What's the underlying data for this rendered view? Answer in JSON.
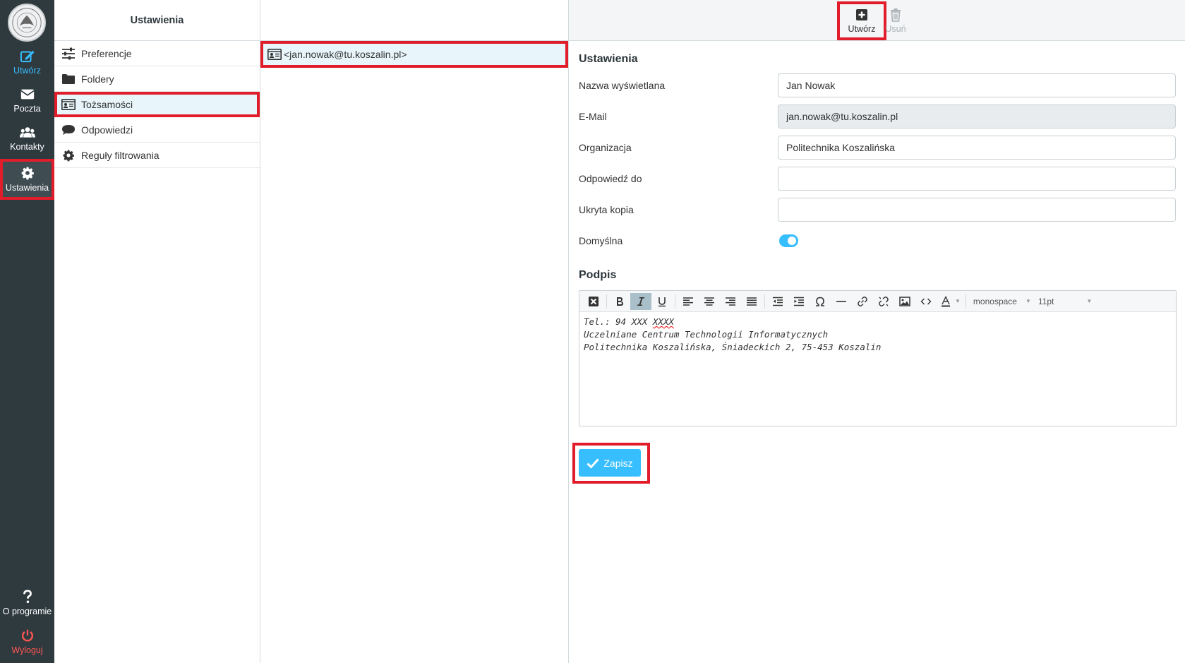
{
  "appbar": {
    "items": [
      {
        "label": "Utwórz",
        "icon": "compose-icon"
      },
      {
        "label": "Poczta",
        "icon": "envelope-icon"
      },
      {
        "label": "Kontakty",
        "icon": "users-icon"
      },
      {
        "label": "Ustawienia",
        "icon": "gear-icon"
      }
    ],
    "bottom": [
      {
        "label": "O programie",
        "icon": "question-icon"
      },
      {
        "label": "Wyloguj",
        "icon": "power-icon"
      }
    ]
  },
  "nav": {
    "title": "Ustawienia",
    "items": [
      {
        "label": "Preferencje",
        "icon": "sliders-icon"
      },
      {
        "label": "Foldery",
        "icon": "folder-icon"
      },
      {
        "label": "Tożsamości",
        "icon": "id-card-icon"
      },
      {
        "label": "Odpowiedzi",
        "icon": "comment-icon"
      },
      {
        "label": "Reguły filtrowania",
        "icon": "gear-icon"
      }
    ]
  },
  "list": {
    "items": [
      {
        "label": "<jan.nowak@tu.koszalin.pl>",
        "icon": "id-card-icon"
      }
    ]
  },
  "toolbar": {
    "create_label": "Utwórz",
    "delete_label": "Usuń"
  },
  "form": {
    "section_title": "Ustawienia",
    "display_name_label": "Nazwa wyświetlana",
    "display_name_value": "Jan Nowak",
    "email_label": "E-Mail",
    "email_value": "jan.nowak@tu.koszalin.pl",
    "organization_label": "Organizacja",
    "organization_value": "Politechnika Koszalińska",
    "reply_to_label": "Odpowiedź do",
    "reply_to_value": "",
    "bcc_label": "Ukryta kopia",
    "bcc_value": "",
    "default_label": "Domyślna",
    "default_value": "on"
  },
  "signature": {
    "section_title": "Podpis",
    "font_family": "monospace",
    "font_size": "11pt",
    "line1_prefix": "Tel.: 94 XXX ",
    "line1_spell": "XXXX",
    "line2": "Uczelniane Centrum Technologii Informatycznych",
    "line3": "Politechnika Koszalińska, Śniadeckich 2, 75-453 Koszalin"
  },
  "actions": {
    "save_label": "Zapisz"
  },
  "colors": {
    "accent": "#37beff",
    "sidebar_bg": "#2f3a3f",
    "highlight": "#e11d2b",
    "logout": "#ff5552"
  }
}
